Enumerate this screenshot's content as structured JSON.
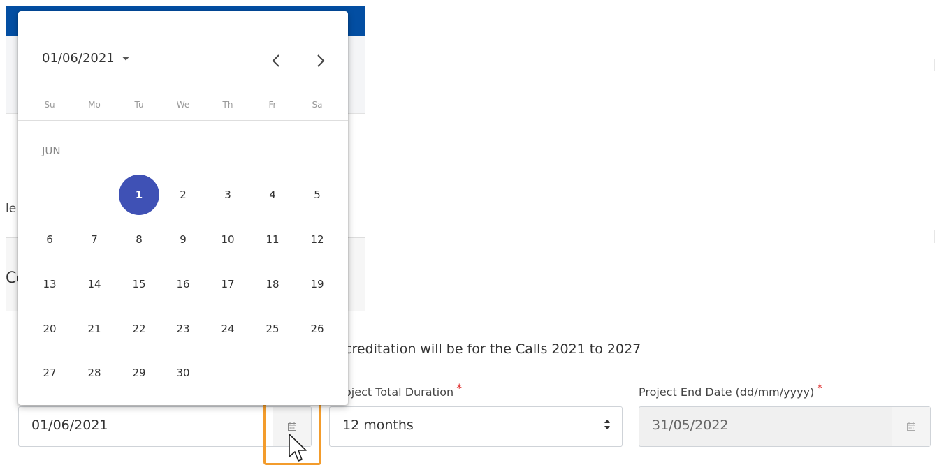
{
  "background": {
    "fragment_left": "le",
    "fragment_heading": "Co",
    "accreditation_text": "creditation will be for the Calls 2021 to 2027"
  },
  "form": {
    "start_date": {
      "value": "01/06/2021",
      "icon": "calendar-icon"
    },
    "duration": {
      "label": "oject Total Duration",
      "value": "12 months",
      "required_mark": "*"
    },
    "end_date": {
      "label": "Project End Date (dd/mm/yyyy)",
      "value": "31/05/2022",
      "required_mark": "*",
      "icon": "calendar-icon"
    }
  },
  "datepicker": {
    "header_value": "01/06/2021",
    "prev_icon": "chevron-left-icon",
    "next_icon": "chevron-right-icon",
    "weekdays": [
      "Su",
      "Mo",
      "Tu",
      "We",
      "Th",
      "Fr",
      "Sa"
    ],
    "month_label": "JUN",
    "days": [
      "1",
      "2",
      "3",
      "4",
      "5",
      "6",
      "7",
      "8",
      "9",
      "10",
      "11",
      "12",
      "13",
      "14",
      "15",
      "16",
      "17",
      "18",
      "19",
      "20",
      "21",
      "22",
      "23",
      "24",
      "25",
      "26",
      "27",
      "28",
      "29",
      "30"
    ],
    "selected_day": "1"
  },
  "colors": {
    "selected_day": "#3f51b5",
    "highlight_border": "#f39c2c",
    "required": "#e0302f",
    "top_bar": "#034ea2"
  }
}
